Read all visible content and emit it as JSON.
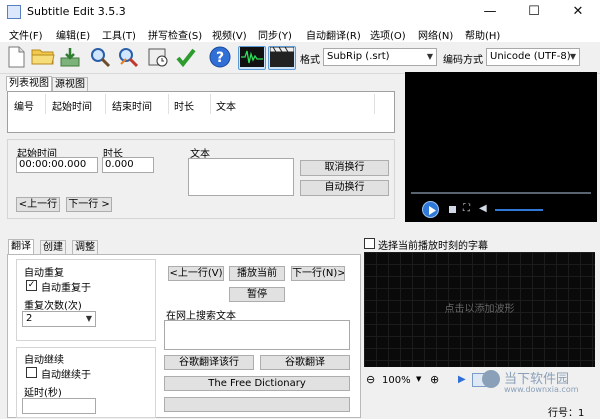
{
  "titlebar": {
    "title": "Subtitle Edit 3.5.3",
    "min": "—",
    "max": "☐",
    "close": "✕"
  },
  "menu": [
    {
      "label": "文件(F)"
    },
    {
      "label": "编辑(E)"
    },
    {
      "label": "工具(T)"
    },
    {
      "label": "拼写检查(S)"
    },
    {
      "label": "视频(V)"
    },
    {
      "label": "同步(Y)"
    },
    {
      "label": "自动翻译(R)"
    },
    {
      "label": "选项(O)"
    },
    {
      "label": "网络(N)"
    },
    {
      "label": "帮助(H)"
    }
  ],
  "toolbar": {
    "format_label": "格式",
    "format_value": "SubRip (.srt)",
    "encoding_label": "编码方式",
    "encoding_value": "Unicode (UTF-8)",
    "icons": [
      "new-file-icon",
      "open-folder-icon",
      "save-icon",
      "find-icon",
      "replace-icon",
      "visual-sync-icon",
      "spell-check-icon",
      "help-icon",
      "waveform-icon",
      "video-icon"
    ]
  },
  "subtitle_tabs": {
    "list_view": "列表视图",
    "source_view": "源视图"
  },
  "grid_headers": [
    "编号",
    "起始时间",
    "结束时间",
    "时长",
    "文本"
  ],
  "edit": {
    "start_label": "起始时间",
    "start_value": "00:00:00.000",
    "duration_label": "时长",
    "duration_value": "0.000",
    "text_label": "文本",
    "unbreak_button": "取消换行",
    "autobreak_button": "自动换行",
    "prev_button": "<上一行",
    "next_button": "下一行 >"
  },
  "bottom_tabs": {
    "translate": "翻译",
    "create": "创建",
    "adjust": "调整"
  },
  "translate_panel": {
    "auto_repeat_group": "自动重复",
    "auto_repeat_on": "自动重复于",
    "auto_repeat_checked": true,
    "repeat_count_label": "重复次数(次)",
    "repeat_count_value": "2",
    "auto_continue_group": "自动继续",
    "auto_continue_on": "自动继续于",
    "auto_continue_checked": false,
    "delay_label": "延时(秒)",
    "prev_line_button": "<上一行(V)",
    "play_current_button": "播放当前",
    "next_line_button": "下一行(N)>",
    "pause_button": "暂停",
    "search_web_label": "在网上搜索文本",
    "google_translate_it": "谷歌翻译该行",
    "google_translate": "谷歌翻译",
    "free_dictionary": "The Free Dictionary"
  },
  "waveform": {
    "select_current_label": "选择当前播放时刻的字幕",
    "placeholder": "点击以添加波形",
    "zoom_value": "100%"
  },
  "status": {
    "line": "行号：1"
  },
  "watermark": {
    "text": "当下软件园",
    "url": "www.downxia.com"
  }
}
